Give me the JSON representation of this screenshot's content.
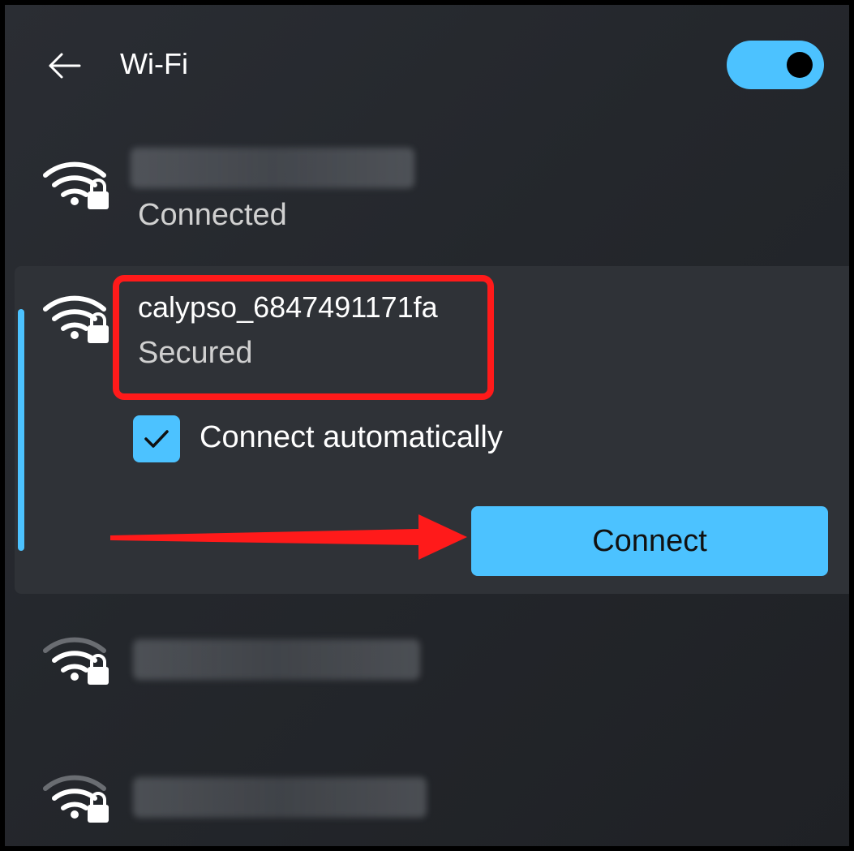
{
  "header": {
    "title": "Wi-Fi",
    "toggle_on": true
  },
  "networks": [
    {
      "status": "Connected",
      "icon": "wifi-secured-icon"
    },
    {
      "name": "calypso_6847491171fa",
      "status": "Secured",
      "icon": "wifi-secured-icon",
      "connect_auto_label": "Connect automatically",
      "connect_auto_checked": true,
      "connect_label": "Connect"
    },
    {
      "icon": "wifi-secured-weak-icon"
    },
    {
      "icon": "wifi-secured-weak-icon"
    }
  ],
  "colors": {
    "accent": "#4cc2ff",
    "highlight": "#ff1a1a",
    "background": "#26292e"
  }
}
